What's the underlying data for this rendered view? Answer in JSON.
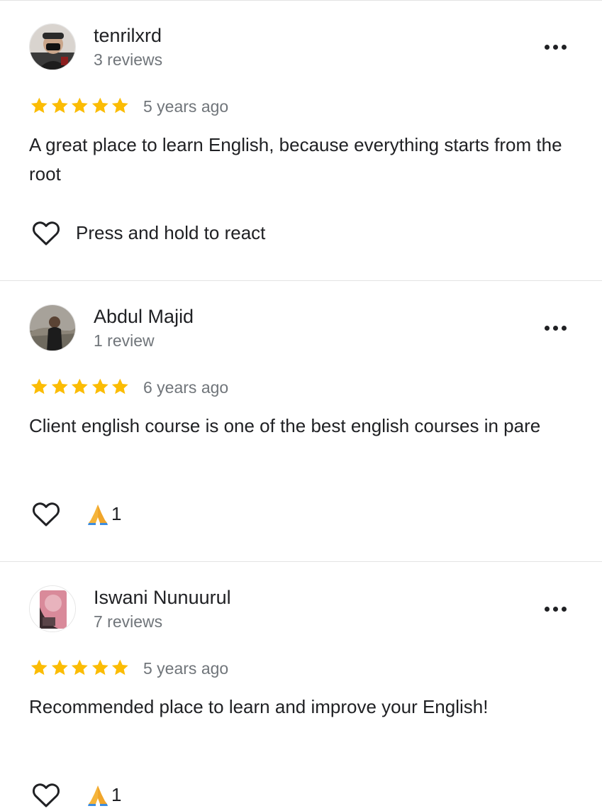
{
  "reviews": [
    {
      "name": "tenrilxrd",
      "count": "3 reviews",
      "rating": 5,
      "date": "5 years ago",
      "text": "A great place to learn English, because everything starts from the root",
      "react_label": "Press and hold to react",
      "reaction_count": null,
      "avatar": "avatar-man-cap"
    },
    {
      "name": "Abdul Majid",
      "count": "1 review",
      "rating": 5,
      "date": "6 years ago",
      "text": "Client english course is one of the best english courses in pare",
      "react_label": null,
      "reaction_count": "1",
      "reaction_icon": "folded-hands-emoji",
      "avatar": "avatar-man-outdoor"
    },
    {
      "name": "Iswani Nunuurul",
      "count": "7 reviews",
      "rating": 5,
      "date": "5 years ago",
      "text": "Recommended place to learn and improve your English!",
      "react_label": null,
      "reaction_count": "1",
      "reaction_icon": "folded-hands-emoji",
      "avatar": "avatar-pink-photo"
    }
  ],
  "icons": {
    "menu": "more-horizontal-icon",
    "star": "star-icon",
    "like": "heart-outline-icon"
  },
  "colors": {
    "star": "#fbbc04",
    "secondary_text": "#70757a",
    "primary_text": "#202124",
    "divider": "#e3e3e3"
  }
}
